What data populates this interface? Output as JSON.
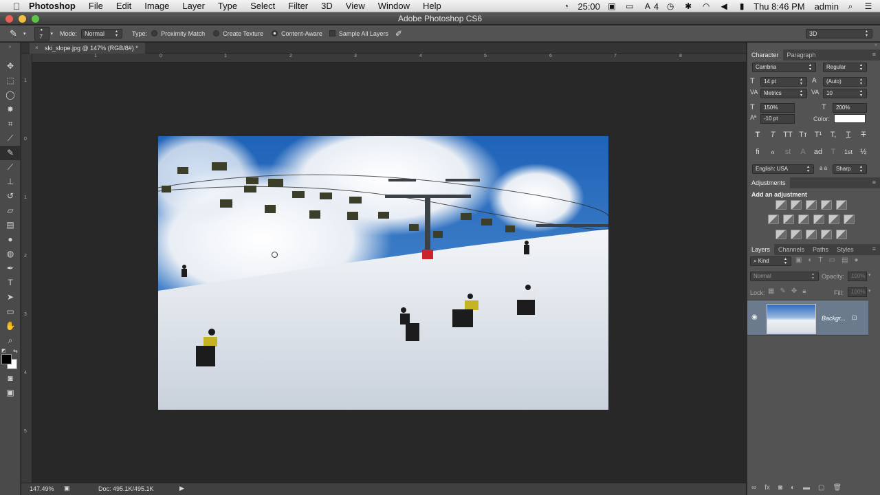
{
  "menubar": {
    "app": "Photoshop",
    "items": [
      "File",
      "Edit",
      "Image",
      "Layer",
      "Type",
      "Select",
      "Filter",
      "3D",
      "View",
      "Window",
      "Help"
    ],
    "timer": "25:00",
    "badge": "4",
    "clock": "Thu 8:46 PM",
    "user": "admin"
  },
  "window": {
    "title": "Adobe Photoshop CS6"
  },
  "options": {
    "brush_size": "7",
    "mode_label": "Mode:",
    "mode_value": "Normal",
    "type_label": "Type:",
    "proximity": "Proximity Match",
    "create_texture": "Create Texture",
    "content_aware": "Content-Aware",
    "sample_all": "Sample All Layers",
    "workspace": "3D"
  },
  "document": {
    "tab": "ski_slope.jpg @ 147% (RGB/8#) *",
    "zoom": "147.49%",
    "doc_size": "Doc: 495.1K/495.1K",
    "hruler": [
      "1",
      "0",
      "1",
      "2",
      "3",
      "4",
      "5",
      "6",
      "7",
      "8"
    ],
    "vruler": [
      "1",
      "0",
      "1",
      "2",
      "3",
      "4",
      "5"
    ]
  },
  "character": {
    "tabs": [
      "Character",
      "Paragraph"
    ],
    "font_family": "Cambria",
    "font_style": "Regular",
    "font_size": "14 pt",
    "leading": "(Auto)",
    "kerning": "Metrics",
    "tracking": "10",
    "vscale": "150%",
    "hscale": "200%",
    "baseline": "-10 pt",
    "color_label": "Color:",
    "type_styles": [
      "T",
      "T",
      "TT",
      "Tт",
      "T¹",
      "T,",
      "T",
      "T"
    ],
    "ot_features": [
      "ﬁ",
      "ℴ",
      "st",
      "A",
      "ad",
      "T",
      "1st",
      "½"
    ],
    "language": "English: USA",
    "aa_label": "a a",
    "antialias": "Sharp"
  },
  "adjustments": {
    "tab": "Adjustments",
    "heading": "Add an adjustment"
  },
  "layers": {
    "tabs": [
      "Layers",
      "Channels",
      "Paths",
      "Styles"
    ],
    "kind": "Kind",
    "blend": "Normal",
    "opacity_label": "Opacity:",
    "opacity": "100%",
    "lock_label": "Lock:",
    "fill_label": "Fill:",
    "fill": "100%",
    "layer_name": "Backgr..."
  }
}
